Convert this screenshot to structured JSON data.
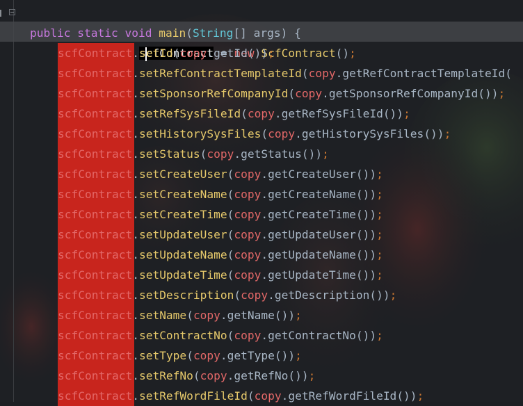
{
  "editor": {
    "signature": {
      "mod1": "public",
      "mod2": "static",
      "ret": "void",
      "name": "main",
      "open": "(",
      "ptype": "String",
      "arr": "[] ",
      "pname": "args",
      "close": ") {"
    },
    "decl": {
      "type": "ScfContract",
      "var_a": "s",
      "var_b": "cfContract",
      "eq": " = ",
      "kw_new": "new",
      "ctor": "ScfContract",
      "parens": "()",
      "semi": ";"
    },
    "receiver": "scfContract",
    "arg": "copy",
    "calls": [
      {
        "setter": "setId",
        "getter": "getId"
      },
      {
        "setter": "setRefContractTemplateId",
        "getter": "getRefContractTemplateId",
        "truncated": true
      },
      {
        "setter": "setSponsorRefCompanyId",
        "getter": "getSponsorRefCompanyId"
      },
      {
        "setter": "setRefSysFileId",
        "getter": "getRefSysFileId"
      },
      {
        "setter": "setHistorySysFiles",
        "getter": "getHistorySysFiles"
      },
      {
        "setter": "setStatus",
        "getter": "getStatus"
      },
      {
        "setter": "setCreateUser",
        "getter": "getCreateUser"
      },
      {
        "setter": "setCreateName",
        "getter": "getCreateName"
      },
      {
        "setter": "setCreateTime",
        "getter": "getCreateTime"
      },
      {
        "setter": "setUpdateUser",
        "getter": "getUpdateUser"
      },
      {
        "setter": "setUpdateName",
        "getter": "getUpdateName"
      },
      {
        "setter": "setUpdateTime",
        "getter": "getUpdateTime"
      },
      {
        "setter": "setDescription",
        "getter": "getDescription"
      },
      {
        "setter": "setName",
        "getter": "getName"
      },
      {
        "setter": "setContractNo",
        "getter": "getContractNo"
      },
      {
        "setter": "setType",
        "getter": "getType"
      },
      {
        "setter": "setRefNo",
        "getter": "getRefNo"
      },
      {
        "setter": "setRefWordFileId",
        "getter": "getRefWordFileId"
      }
    ]
  },
  "colors": {
    "highlight": "#c8251d",
    "method": "#e6c96b",
    "type": "#62c6d6",
    "variable": "#e36868",
    "keyword": "#cc7832"
  }
}
